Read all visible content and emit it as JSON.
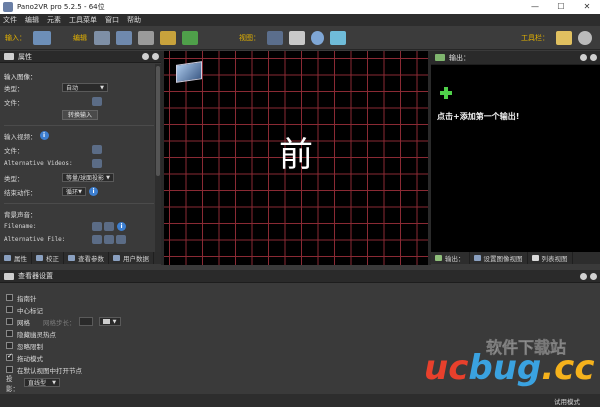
{
  "window": {
    "title": "Pano2VR pro 5.2.5 - 64位",
    "buttons": [
      "—",
      "☐",
      "✕"
    ]
  },
  "menu": [
    "文件",
    "编辑",
    "元素",
    "工具菜单",
    "窗口",
    "帮助"
  ],
  "toolbar": {
    "input_label": "输入：",
    "edit_label": "编辑",
    "view_label": "视图：",
    "tools_label": "工具栏："
  },
  "properties_panel": {
    "title": "属性",
    "input_image": {
      "heading": "输入图像：",
      "type_label": "类型：",
      "type_value": "自动",
      "file_label": "文件：",
      "convert_button": "转换输入"
    },
    "input_video": {
      "heading": "输入视频：",
      "file_label": "文件：",
      "alt_label": "Alternative Videos:",
      "type_label": "类型：",
      "type_value": "等量/球面投影",
      "end_label": "结束动作：",
      "end_value": "循环"
    },
    "background_audio": {
      "heading": "背景声音：",
      "filename_label": "Filename:",
      "alt_label": "Alternative File:"
    }
  },
  "left_tabs": [
    "属性",
    "校正",
    "查看参数",
    "用户数据"
  ],
  "viewer": {
    "face_label": "前"
  },
  "output_panel": {
    "title": "输出：",
    "hint": "点击+添加第一个输出!"
  },
  "right_tabs": [
    "输出：",
    "设置图像视图",
    "列表视图"
  ],
  "viewer_settings": {
    "title": "查看器设置",
    "options": [
      {
        "label": "指南针",
        "checked": false
      },
      {
        "label": "中心标记",
        "checked": false
      },
      {
        "label": "网格",
        "checked": false
      },
      {
        "label": "隐藏幽灵热点",
        "checked": false
      },
      {
        "label": "忽略限制",
        "checked": false
      },
      {
        "label": "拖动模式",
        "checked": true
      },
      {
        "label": "在默认视图中打开节点",
        "checked": false
      }
    ],
    "grid_step_label": "网格步长：",
    "projection_label": "投影：",
    "projection_value": "直线型"
  },
  "status": {
    "mode": "试用模式"
  },
  "watermark": {
    "sub": "软件下载站",
    "main_a": "uc",
    "main_b": "bug",
    "main_c": ".cc"
  }
}
